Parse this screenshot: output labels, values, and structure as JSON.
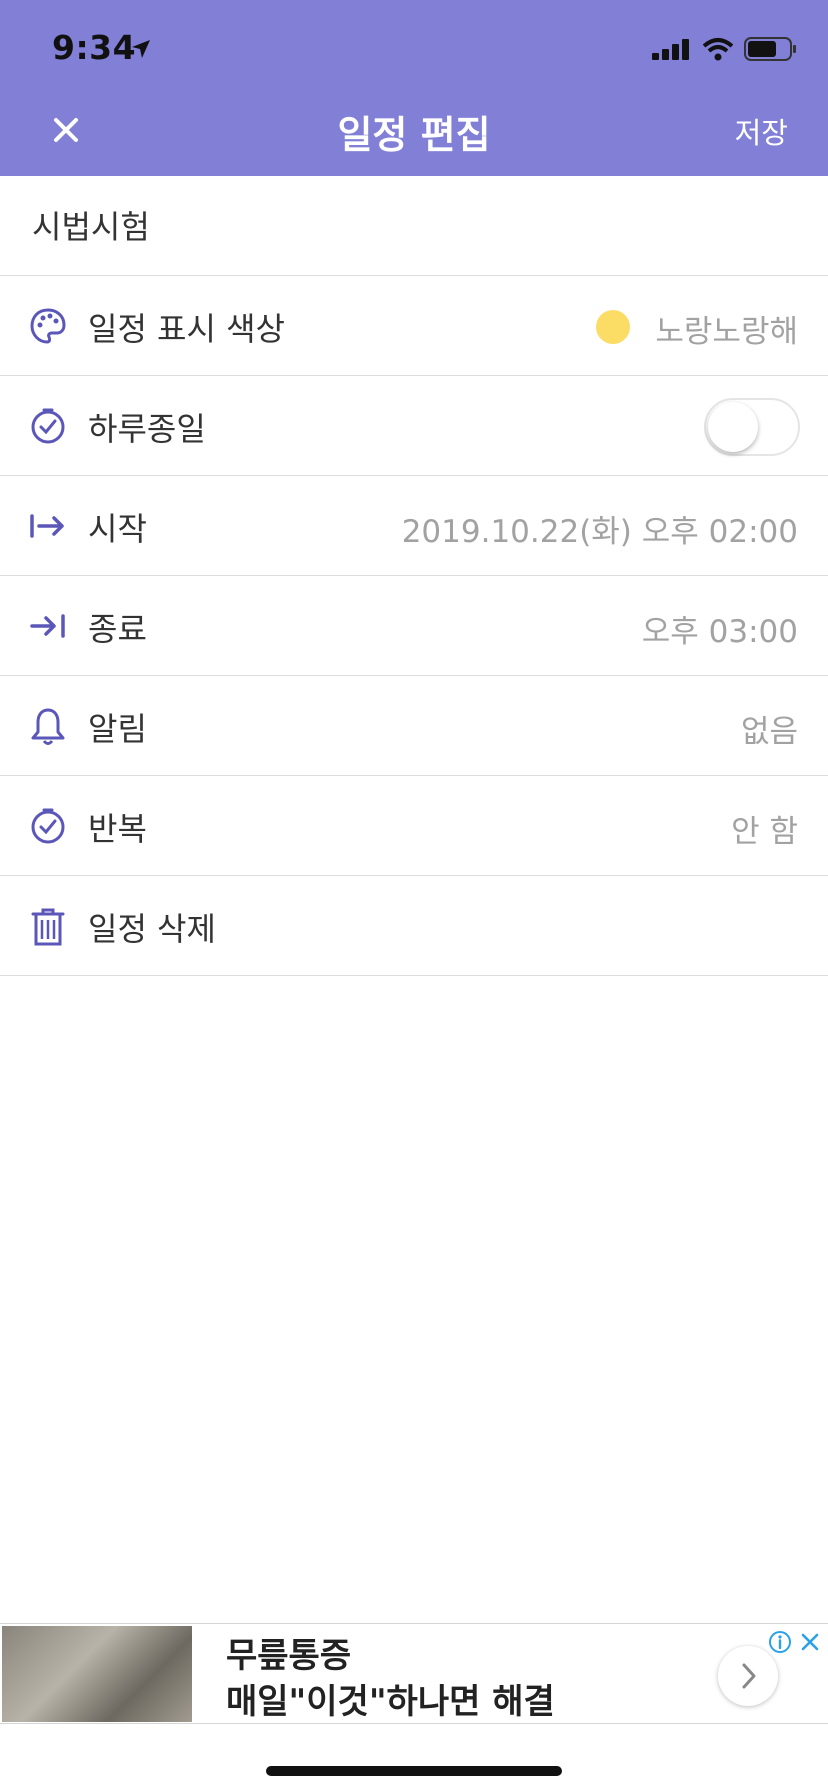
{
  "status_bar": {
    "time": "9:34"
  },
  "header": {
    "title": "일정 편집",
    "save_label": "저장"
  },
  "event_title": "시법시험",
  "rows": [
    {
      "label": "일정 표시 색상",
      "value": "노랑노랑해",
      "icon": "palette-icon"
    },
    {
      "label": "하루종일",
      "value": "",
      "icon": "clock-icon",
      "toggle_on": false
    },
    {
      "label": "시작",
      "value": "2019.10.22(화) 오후 02:00",
      "icon": "arrow-right-bar-icon"
    },
    {
      "label": "종료",
      "value": "오후 03:00",
      "icon": "arrow-to-bar-icon"
    },
    {
      "label": "알림",
      "value": "없음",
      "icon": "bell-icon"
    },
    {
      "label": "반복",
      "value": "안 함",
      "icon": "clock-icon"
    },
    {
      "label": "일정 삭제",
      "value": "",
      "icon": "trash-icon"
    }
  ],
  "ad": {
    "line1": "무릎통증",
    "line2": "매일\"이것\"하나면 해결"
  },
  "colors": {
    "accent": "#8180d6",
    "icon": "#5b57b8",
    "selected_color": "#fbdc65"
  }
}
